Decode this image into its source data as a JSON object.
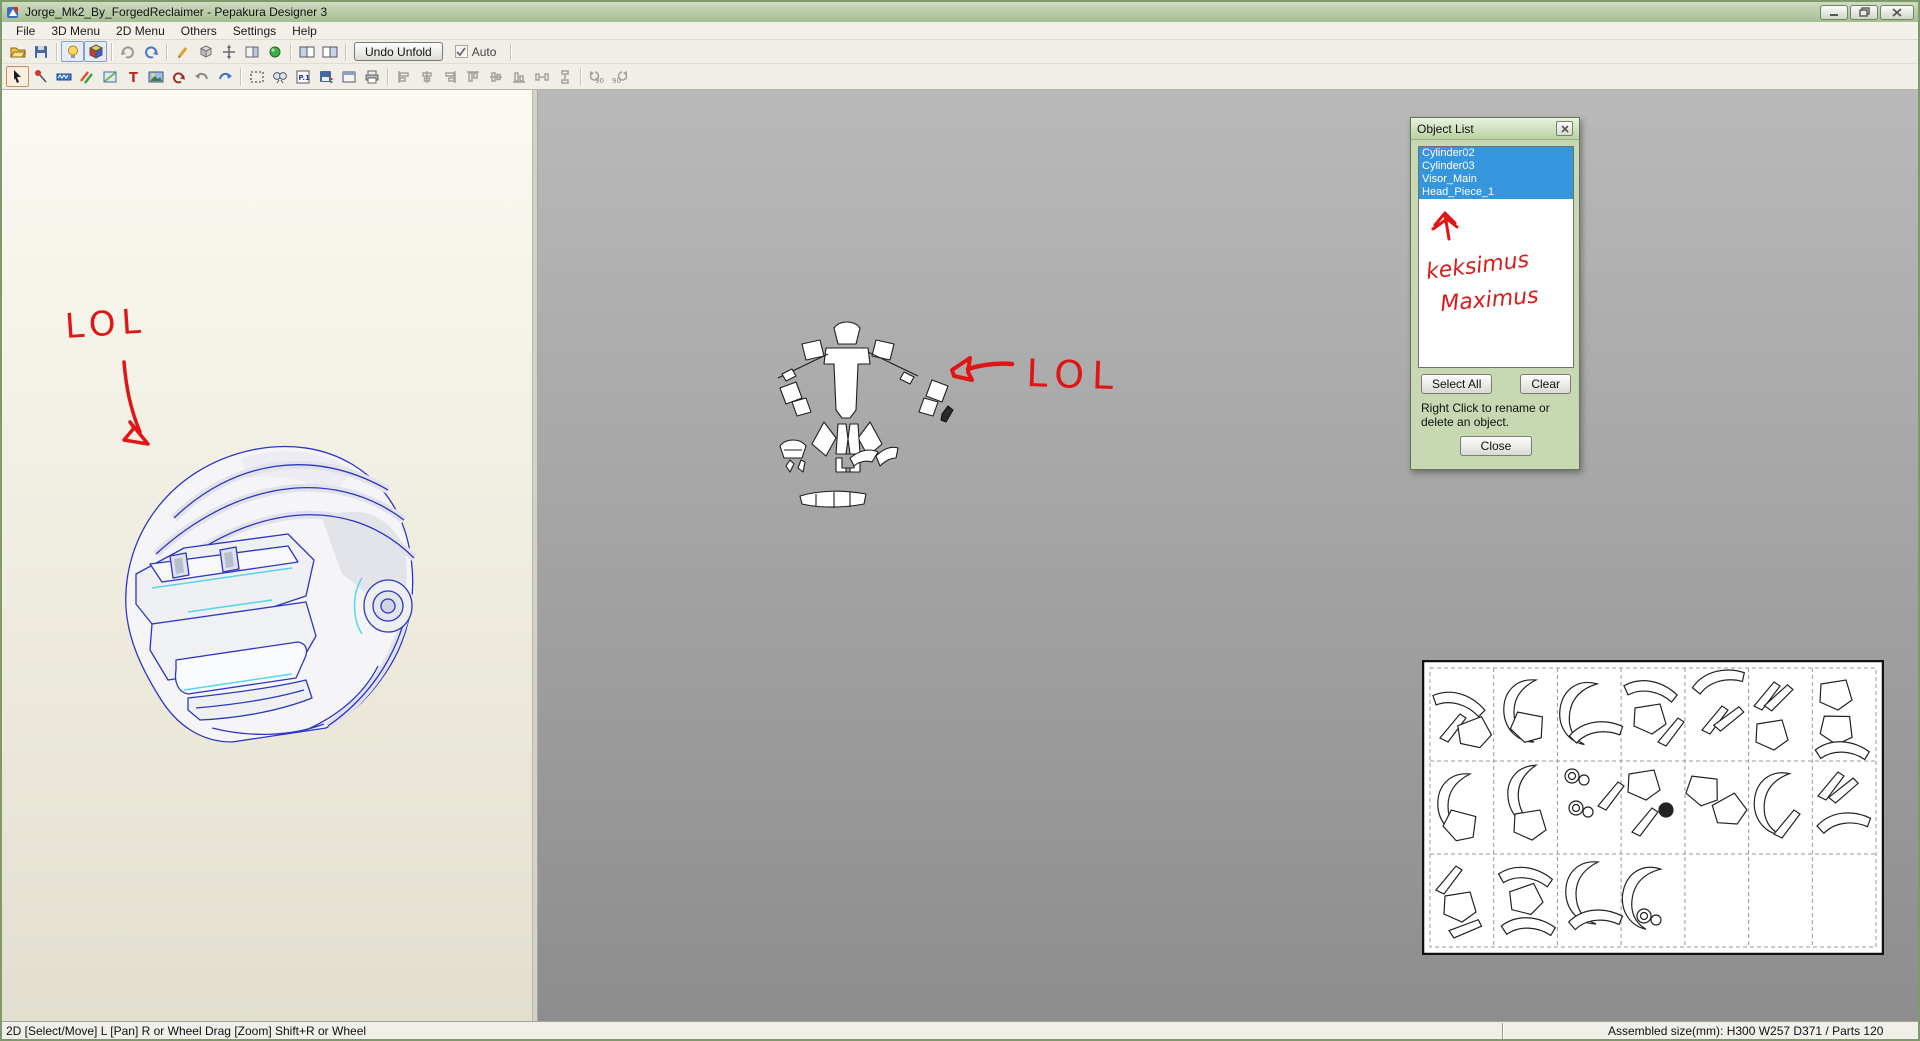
{
  "window": {
    "title": "Jorge_Mk2_By_ForgedReclaimer - Pepakura Designer 3",
    "controls": [
      "minimize",
      "restore",
      "close"
    ]
  },
  "menu": {
    "items": [
      "File",
      "3D Menu",
      "2D Menu",
      "Others",
      "Settings",
      "Help"
    ]
  },
  "toolbar_main": {
    "icons": [
      "open-icon",
      "save-icon",
      "render-light-icon",
      "texture-view-icon",
      "view-rotate-gray-icon",
      "view-rotate-blue-icon",
      "edit-pencil-icon",
      "solid-box-icon",
      "move-axis-icon",
      "side-panel-icon",
      "select-sphere-icon",
      "layout-left-icon",
      "layout-right-icon"
    ],
    "undo_unfold_label": "Undo Unfold",
    "auto_label": "Auto"
  },
  "toolbar_2d": {
    "icons": [
      "select-arrow-icon",
      "pin-icon",
      "tape-measure-icon",
      "color-pencils-icon",
      "texture-edit-icon",
      "text-tool-icon",
      "image-tool-icon",
      "rotate-part-icon",
      "undo-icon",
      "redo-icon",
      "marquee-icon",
      "zoom-parts-icon",
      "page-number-icon",
      "export-icon",
      "window-icon",
      "print-icon",
      "align-left-icon",
      "align-center-icon",
      "align-right-icon",
      "align-top-icon",
      "align-middle-icon",
      "align-bottom-icon",
      "distribute-h-icon",
      "distribute-v-icon",
      "rotate-90-ccw-icon",
      "rotate-90-cw-icon"
    ],
    "rotate_ccw_label": "90",
    "rotate_cw_label": "90"
  },
  "viewport_3d": {
    "annotation": "LOL"
  },
  "viewport_2d": {
    "annotation": "LOL"
  },
  "object_list": {
    "title": "Object List",
    "items": [
      "Cylinder02",
      "Cylinder03",
      "Visor_Main",
      "Head_Piece_1"
    ],
    "select_all_label": "Select All",
    "clear_label": "Clear",
    "hint_line1": "Right Click to rename or",
    "hint_line2": "delete an object.",
    "close_label": "Close",
    "scribble_line1": "keksimus",
    "scribble_line2": "Maximus"
  },
  "status_bar": {
    "left": "2D [Select/Move] L [Pan] R or Wheel Drag [Zoom] Shift+R or Wheel",
    "right": "Assembled size(mm): H300 W257 D371 / Parts 120"
  },
  "colors": {
    "selection_blue": "#3595dd",
    "annotation_red": "#e01616",
    "chrome_green": "#a6bd93",
    "wireframe_blue": "#2d36c2",
    "accent_cyan": "#55d6ea"
  }
}
